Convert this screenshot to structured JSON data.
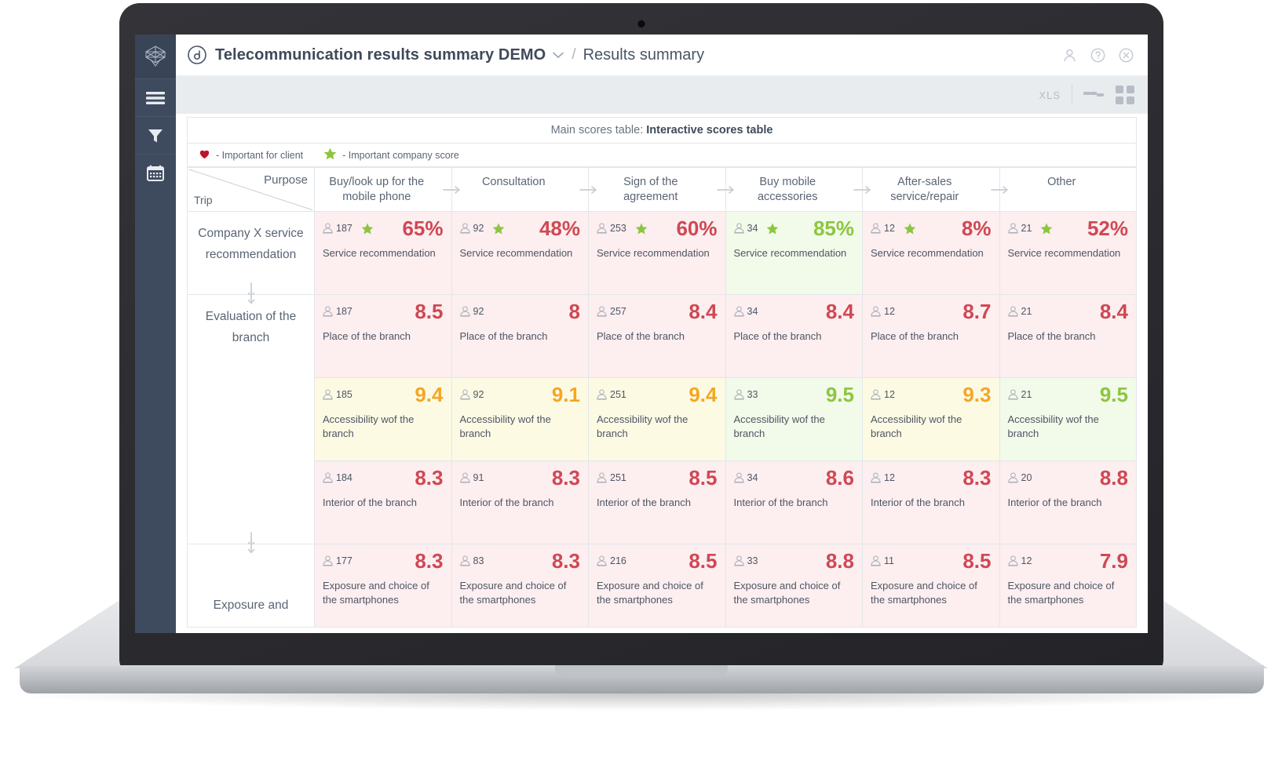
{
  "app": {
    "title": "Telecommunication results summary DEMO",
    "separator": "/",
    "subtitle": "Results summary"
  },
  "sidebar": {
    "items": [
      {
        "name": "logo",
        "icon": "cube-logo-icon",
        "label": ""
      },
      {
        "name": "menu",
        "icon": "hamburger-menu-icon",
        "label": ""
      },
      {
        "name": "filter",
        "icon": "funnel-filter-icon",
        "label": ""
      },
      {
        "name": "calendar",
        "icon": "calendar-icon",
        "label": ""
      }
    ]
  },
  "topbar": {
    "icons": [
      {
        "name": "user-icon",
        "label": "User"
      },
      {
        "name": "help-icon",
        "label": "Help"
      },
      {
        "name": "close-icon",
        "label": "Close"
      }
    ]
  },
  "toolbar": {
    "export_label": "XLS",
    "view_list_label": "List view",
    "view_grid_label": "Grid view"
  },
  "panel": {
    "title_prefix": "Main scores table:",
    "title_value": "Interactive scores table"
  },
  "legend": {
    "items": [
      {
        "icon": "heart-icon",
        "color": "#c0122b",
        "text": "- Important for client"
      },
      {
        "icon": "star-icon",
        "color": "#8cc63f",
        "text": "- Important company score"
      }
    ]
  },
  "table": {
    "corner": {
      "purpose": "Purpose",
      "trip": "Trip"
    },
    "columns": [
      "Buy/look up for the mobile phone",
      "Consultation",
      "Sign of the agreement",
      "Buy mobile accessories",
      "After-sales service/repair",
      "Other"
    ],
    "row_groups": [
      {
        "label": "Company X service recommendation",
        "rows": 1
      },
      {
        "label": "Evaluation of the branch",
        "rows": 3
      },
      {
        "label": "Exposure and",
        "rows": 1
      }
    ],
    "rows": [
      {
        "group": "Company X service recommendation",
        "label": "Service recommendation",
        "cells": [
          {
            "count": "187",
            "star": true,
            "value": "65%",
            "tone": "red"
          },
          {
            "count": "92",
            "star": true,
            "value": "48%",
            "tone": "red"
          },
          {
            "count": "253",
            "star": true,
            "value": "60%",
            "tone": "red"
          },
          {
            "count": "34",
            "star": true,
            "value": "85%",
            "tone": "green"
          },
          {
            "count": "12",
            "star": true,
            "value": "8%",
            "tone": "red"
          },
          {
            "count": "21",
            "star": true,
            "value": "52%",
            "tone": "red"
          }
        ]
      },
      {
        "group": "Evaluation of the branch",
        "label": "Place of the branch",
        "cells": [
          {
            "count": "187",
            "star": false,
            "value": "8.5",
            "tone": "red"
          },
          {
            "count": "92",
            "star": false,
            "value": "8",
            "tone": "red"
          },
          {
            "count": "257",
            "star": false,
            "value": "8.4",
            "tone": "red"
          },
          {
            "count": "34",
            "star": false,
            "value": "8.4",
            "tone": "red"
          },
          {
            "count": "12",
            "star": false,
            "value": "8.7",
            "tone": "red"
          },
          {
            "count": "21",
            "star": false,
            "value": "8.4",
            "tone": "red"
          }
        ]
      },
      {
        "group": "Evaluation of the branch",
        "label": "Accessibility wof the branch",
        "cells": [
          {
            "count": "185",
            "star": false,
            "value": "9.4",
            "tone": "yellow"
          },
          {
            "count": "92",
            "star": false,
            "value": "9.1",
            "tone": "yellow"
          },
          {
            "count": "251",
            "star": false,
            "value": "9.4",
            "tone": "yellow"
          },
          {
            "count": "33",
            "star": false,
            "value": "9.5",
            "tone": "green"
          },
          {
            "count": "12",
            "star": false,
            "value": "9.3",
            "tone": "yellow"
          },
          {
            "count": "21",
            "star": false,
            "value": "9.5",
            "tone": "green"
          }
        ]
      },
      {
        "group": "Evaluation of the branch",
        "label": "Interior of the branch",
        "cells": [
          {
            "count": "184",
            "star": false,
            "value": "8.3",
            "tone": "red"
          },
          {
            "count": "91",
            "star": false,
            "value": "8.3",
            "tone": "red"
          },
          {
            "count": "251",
            "star": false,
            "value": "8.5",
            "tone": "red"
          },
          {
            "count": "34",
            "star": false,
            "value": "8.6",
            "tone": "red"
          },
          {
            "count": "12",
            "star": false,
            "value": "8.3",
            "tone": "red"
          },
          {
            "count": "20",
            "star": false,
            "value": "8.8",
            "tone": "red"
          }
        ]
      },
      {
        "group": "Exposure and",
        "label": "Exposure and choice of the smartphones",
        "cells": [
          {
            "count": "177",
            "star": false,
            "value": "8.3",
            "tone": "red"
          },
          {
            "count": "83",
            "star": false,
            "value": "8.3",
            "tone": "red"
          },
          {
            "count": "216",
            "star": false,
            "value": "8.5",
            "tone": "red"
          },
          {
            "count": "33",
            "star": false,
            "value": "8.8",
            "tone": "red"
          },
          {
            "count": "11",
            "star": false,
            "value": "8.5",
            "tone": "red"
          },
          {
            "count": "12",
            "star": false,
            "value": "7.9",
            "tone": "red"
          }
        ]
      }
    ]
  },
  "colors": {
    "sidebar_bg": "#3e4a5e",
    "toolbar_bg": "#e9ecef",
    "red": "#cf4853",
    "orange": "#f5a623",
    "green": "#8cc63f",
    "heart": "#c0122b"
  }
}
